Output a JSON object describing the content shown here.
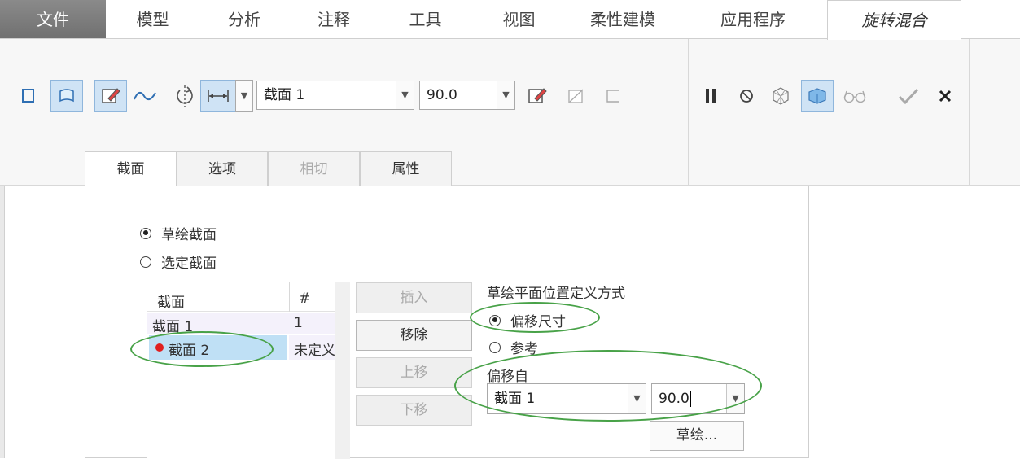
{
  "ribbon_tabs": [
    "文件",
    "模型",
    "分析",
    "注释",
    "工具",
    "视图",
    "柔性建模",
    "应用程序",
    "旋转混合"
  ],
  "toolbar": {
    "section_combo_value": "截面 1",
    "angle_combo_value": "90.0"
  },
  "sub_tabs": [
    "截面",
    "选项",
    "相切",
    "属性"
  ],
  "panel": {
    "radio_sketched": "草绘截面",
    "radio_selected": "选定截面",
    "list_header_section": "截面",
    "list_header_num": "#",
    "rows": [
      {
        "name": "截面 1",
        "num": "1"
      },
      {
        "name": "截面 2",
        "num": "未定义"
      }
    ],
    "btn_insert": "插入",
    "btn_remove": "移除",
    "btn_up": "上移",
    "btn_down": "下移",
    "placement_title": "草绘平面位置定义方式",
    "radio_offset": "偏移尺寸",
    "radio_reference": "参考",
    "offset_from_label": "偏移自",
    "offset_from_value": "截面 1",
    "offset_value": "90.0",
    "btn_sketch": "草绘..."
  },
  "colors": {
    "annotation": "#48a248",
    "selected_row": "#bfe0f5",
    "error_dot": "#e02020"
  }
}
